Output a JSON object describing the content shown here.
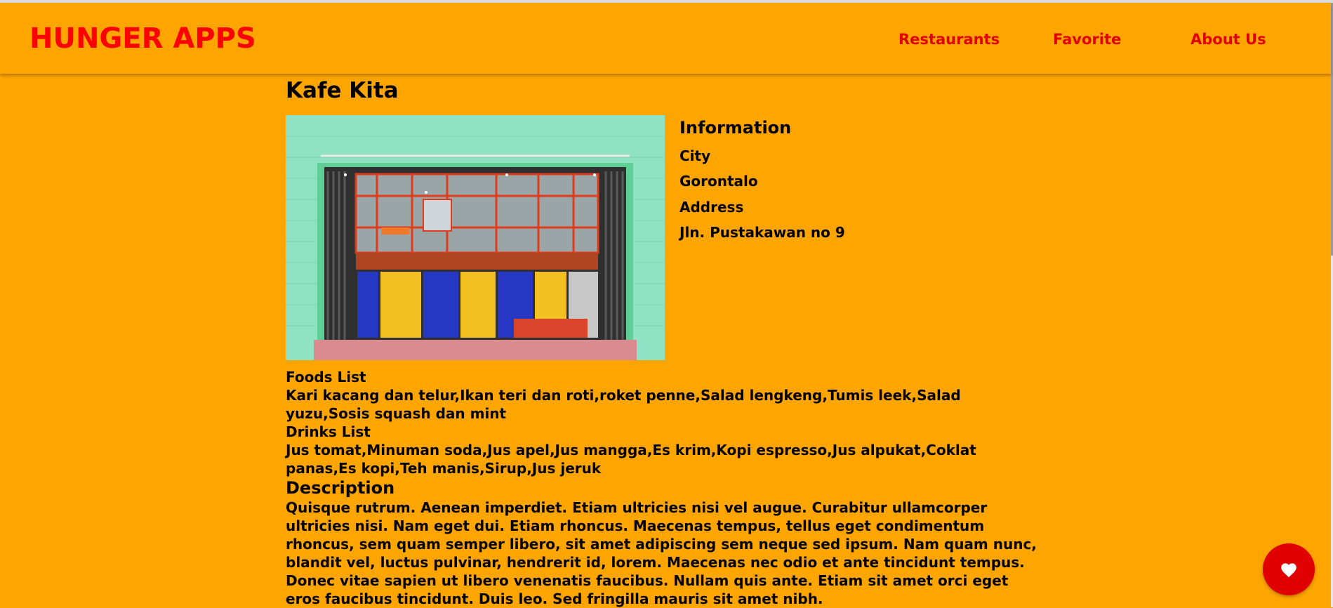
{
  "header": {
    "brand": "HUNGER APPS",
    "nav": [
      {
        "label": "Restaurants"
      },
      {
        "label": "Favorite"
      },
      {
        "label": "About Us"
      }
    ]
  },
  "restaurant": {
    "name": "Kafe Kita",
    "info_heading": "Information",
    "city_label": "City",
    "city": "Gorontalo",
    "address_label": "Address",
    "address": "Jln. Pustakawan no 9",
    "foods_heading": "Foods List",
    "foods": "Kari kacang dan telur,Ikan teri dan roti,roket penne,Salad lengkeng,Tumis leek,Salad yuzu,Sosis squash dan mint",
    "drinks_heading": "Drinks List",
    "drinks": "Jus tomat,Minuman soda,Jus apel,Jus mangga,Es krim,Kopi espresso,Jus alpukat,Coklat panas,Es kopi,Teh manis,Sirup,Jus jeruk",
    "description_heading": "Description",
    "description": "Quisque rutrum. Aenean imperdiet. Etiam ultricies nisi vel augue. Curabitur ullamcorper ultricies nisi. Nam eget dui. Etiam rhoncus. Maecenas tempus, tellus eget condimentum rhoncus, sem quam semper libero, sit amet adipiscing sem neque sed ipsum. Nam quam nunc, blandit vel, luctus pulvinar, hendrerit id, lorem. Maecenas nec odio et ante tincidunt tempus. Donec vitae sapien ut libero venenatis faucibus. Nullam quis ante. Etiam sit amet orci eget eros faucibus tincidunt. Duis leo. Sed fringilla mauris sit amet nibh."
  },
  "icons": {
    "favorite": "heart-icon"
  },
  "colors": {
    "background": "#FFA500",
    "brand": "#FF0000",
    "nav": "#E00000",
    "fab": "#E00000"
  }
}
